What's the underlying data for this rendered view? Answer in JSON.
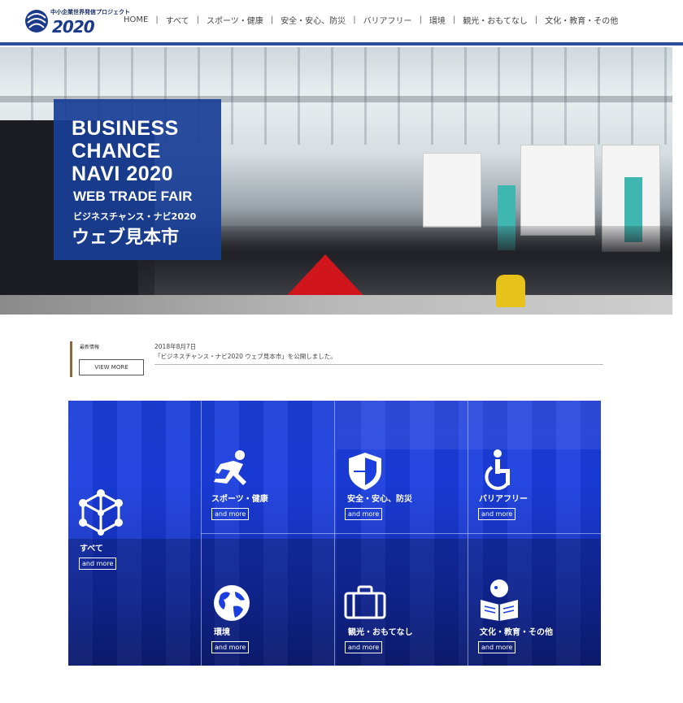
{
  "logo": {
    "small_text": "中小企業世界発信プロジェクト",
    "year": "2020"
  },
  "nav": [
    {
      "label": "HOME"
    },
    {
      "label": "すべて"
    },
    {
      "label": "スポーツ・健康"
    },
    {
      "label": "安全・安心、防災"
    },
    {
      "label": "バリアフリー"
    },
    {
      "label": "環境"
    },
    {
      "label": "観光・おもてなし"
    },
    {
      "label": "文化・教育・その他"
    }
  ],
  "hero": {
    "line1": "BUSINESS",
    "line2": "CHANCE",
    "line3": "NAVI 2020",
    "line4": "WEB TRADE FAIR",
    "jp_sub": "ビジネスチャンス・ナビ2020",
    "jp_title": "ウェブ見本市"
  },
  "news": {
    "label": "最新情報",
    "view_more": "VIEW MORE",
    "date": "2018年8月7日",
    "text": "「ビジネスチャンス・ナビ2020 ウェブ見本市」を公開しました。"
  },
  "categories": [
    {
      "label": "すべて",
      "more": "and more",
      "icon": "cube-network-icon"
    },
    {
      "label": "スポーツ・健康",
      "more": "and more",
      "icon": "running-person-icon"
    },
    {
      "label": "安全・安心、防災",
      "more": "and more",
      "icon": "shield-icon"
    },
    {
      "label": "バリアフリー",
      "more": "and more",
      "icon": "wheelchair-icon"
    },
    {
      "label": "環境",
      "more": "and more",
      "icon": "globe-icon"
    },
    {
      "label": "観光・おもてなし",
      "more": "and more",
      "icon": "suitcase-icon"
    },
    {
      "label": "文化・教育・その他",
      "more": "and more",
      "icon": "reading-person-icon"
    }
  ],
  "colors": {
    "accent": "#2b4f9a",
    "hero_box": "#183e96",
    "grid_blue": "#1a3ee0",
    "news_bar": "#8a6b3e"
  }
}
